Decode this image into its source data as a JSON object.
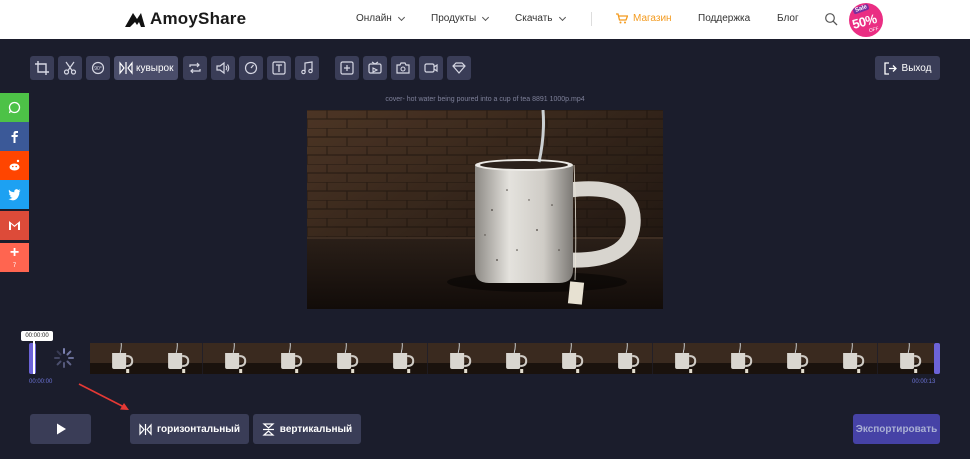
{
  "header": {
    "logo_text": "AmoyShare",
    "nav": {
      "online": "Онлайн",
      "products": "Продукты",
      "download": "Скачать",
      "store": "Магазин",
      "support": "Поддержка",
      "blog": "Блог"
    },
    "sale": {
      "label": "Sale",
      "percent": "50%",
      "off": "OFF"
    }
  },
  "toolbar": {
    "active_label": "кувырок",
    "exit_label": "Выход"
  },
  "share": {
    "count": "7"
  },
  "preview": {
    "filename": "cover- hot water being poured into a cup of tea 8891 1000p.mp4"
  },
  "timeline": {
    "current_time": "00:00:00",
    "start_time": "00:00:00",
    "end_time": "00:00:13"
  },
  "actions": {
    "horizontal_label": "горизонтальный",
    "vertical_label": "вертикальный",
    "export_label": "Экспортировать"
  },
  "colors": {
    "background": "#1b1d2c",
    "button": "#3a3d57",
    "accent": "#6c63d8",
    "export": "#4642a6",
    "store": "#f39a1e"
  }
}
